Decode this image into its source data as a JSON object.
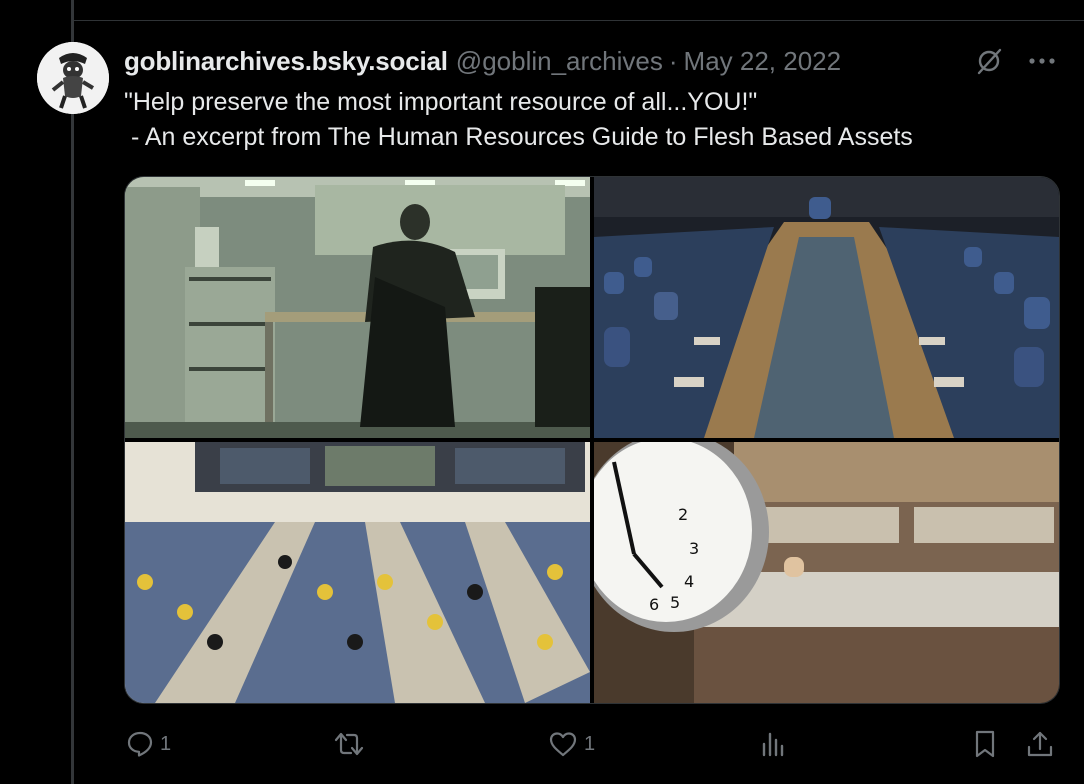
{
  "post": {
    "display_name": "goblinarchives.bsky.social",
    "handle": "@goblin_archives",
    "separator": "·",
    "date": "May 22, 2022",
    "text_line1": "\"Help preserve the most important resource of all...YOU!\"",
    "text_line2": " - An excerpt from The Human Resources Guide to Flesh Based Assets"
  },
  "header_icons": [
    "grok-icon",
    "more-icon"
  ],
  "media": [
    {
      "name": "office-cubicle-photo"
    },
    {
      "name": "conference-room-photo"
    },
    {
      "name": "control-room-photo"
    },
    {
      "name": "clock-office-photo"
    }
  ],
  "clock_numerals": [
    "2",
    "3",
    "4",
    "5",
    "6"
  ],
  "actions": {
    "reply_count": "1",
    "repost_count": "",
    "like_count": "1"
  },
  "colors": {
    "background": "#000000",
    "primary_text": "#e7e9ea",
    "secondary_text": "#71767b",
    "border": "#2f3336"
  }
}
